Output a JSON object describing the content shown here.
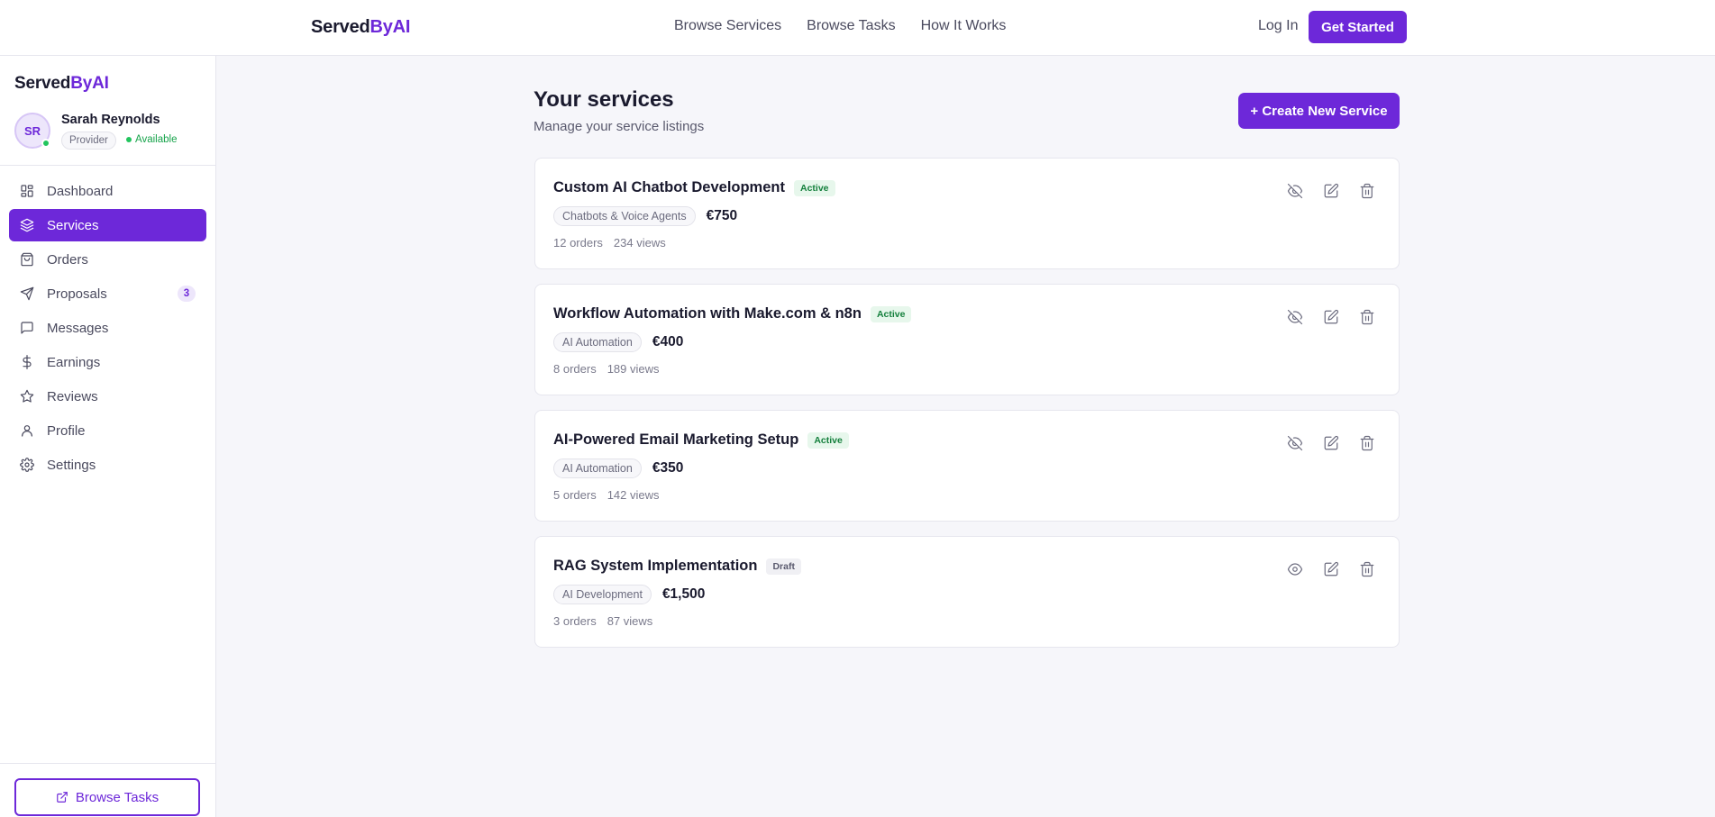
{
  "topnav": {
    "brand_main": "Served",
    "brand_accent": "ByAI",
    "links": [
      "Browse Services",
      "Browse Tasks",
      "How It Works"
    ],
    "login_label": "Log In",
    "cta_label": "Get Started"
  },
  "sidebar": {
    "brand_main": "Served",
    "brand_accent": "ByAI",
    "user": {
      "initials": "SR",
      "name": "Sarah Reynolds",
      "role": "Provider",
      "availability": "Available"
    },
    "items": [
      {
        "label": "Dashboard",
        "icon": "dashboard-icon"
      },
      {
        "label": "Services",
        "icon": "layers-icon",
        "active": true
      },
      {
        "label": "Orders",
        "icon": "shopping-bag-icon"
      },
      {
        "label": "Proposals",
        "icon": "send-icon",
        "count": "3"
      },
      {
        "label": "Messages",
        "icon": "message-icon"
      },
      {
        "label": "Earnings",
        "icon": "dollar-icon"
      },
      {
        "label": "Reviews",
        "icon": "star-icon"
      },
      {
        "label": "Profile",
        "icon": "user-icon"
      },
      {
        "label": "Settings",
        "icon": "gear-icon"
      }
    ],
    "browse_tasks_label": "Browse Tasks"
  },
  "main": {
    "title": "Your services",
    "subtitle": "Manage your service listings",
    "create_label": "+ Create New Service",
    "services": [
      {
        "name": "Custom AI Chatbot Development",
        "status": "Active",
        "category": "Chatbots & Voice Agents",
        "price": "€750",
        "orders": "12 orders",
        "views": "234 views",
        "visibility_icon": "eye-off-icon"
      },
      {
        "name": "Workflow Automation with Make.com & n8n",
        "status": "Active",
        "category": "AI Automation",
        "price": "€400",
        "orders": "8 orders",
        "views": "189 views",
        "visibility_icon": "eye-off-icon"
      },
      {
        "name": "AI-Powered Email Marketing Setup",
        "status": "Active",
        "category": "AI Automation",
        "price": "€350",
        "orders": "5 orders",
        "views": "142 views",
        "visibility_icon": "eye-off-icon"
      },
      {
        "name": "RAG System Implementation",
        "status": "Draft",
        "category": "AI Development",
        "price": "€1,500",
        "orders": "3 orders",
        "views": "87 views",
        "visibility_icon": "eye-icon"
      }
    ]
  },
  "colors": {
    "accent": "#6d28d9",
    "active_status": "#15803d",
    "available": "#22c55e"
  }
}
